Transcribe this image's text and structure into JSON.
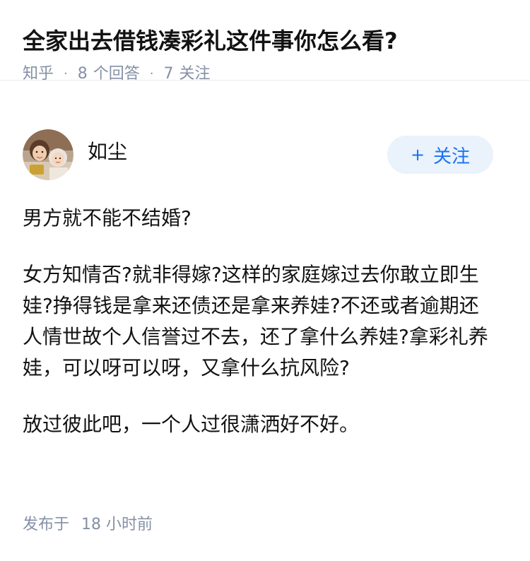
{
  "question": {
    "title": "全家出去借钱凑彩礼这件事你怎么看?"
  },
  "meta": {
    "site": "知乎",
    "answers_count": "8",
    "answers_label": "个回答",
    "followers_count": "7",
    "followers_label": "关注"
  },
  "author": {
    "name": "如尘",
    "follow_plus": "+",
    "follow_label": "关注"
  },
  "answer": {
    "paragraphs": [
      "男方就不能不结婚?",
      "女方知情否?就非得嫁?这样的家庭嫁过去你敢立即生娃?挣得钱是拿来还债还是拿来养娃?不还或者逾期还人情世故个人信誉过不去，还了拿什么养娃?拿彩礼养娃，可以呀可以呀，又拿什么抗风险?",
      "放过彼此吧，一个人过很潇洒好不好。"
    ],
    "published_label": "发布于",
    "published_time": "18 小时前"
  },
  "icons": {
    "avatar": "profile-photo"
  }
}
